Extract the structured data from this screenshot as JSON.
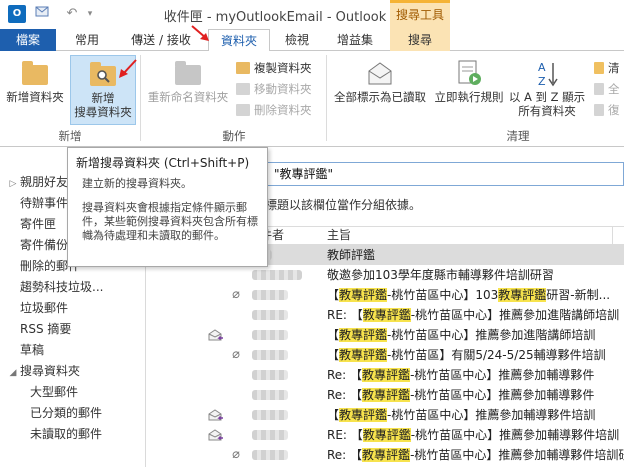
{
  "window": {
    "title": "收件匣 - myOutlookEmail - Outlook",
    "app_icon_label": "O"
  },
  "context_header": "搜尋工具",
  "tabs": [
    {
      "label": "檔案"
    },
    {
      "label": "常用"
    },
    {
      "label": "傳送 / 接收"
    },
    {
      "label": "資料夾"
    },
    {
      "label": "檢視"
    },
    {
      "label": "增益集"
    },
    {
      "label": "搜尋"
    }
  ],
  "ribbon": {
    "new_folder": "新增資料夾",
    "new_search_folder_line1": "新增",
    "new_search_folder_line2": "搜尋資料夾",
    "rename_folder": "重新命名資料夾",
    "copy_folder": "複製資料夾",
    "move_folder": "移動資料夾",
    "delete_folder": "刪除資料夾",
    "mark_all_read": "全部標示為已讀取",
    "run_rules_now": "立即執行規則",
    "sort_az_line1": "以 A 到 Z 顯示",
    "sort_az_line2": "所有資料夾",
    "cleanup_1": "清",
    "cleanup_2": "全",
    "cleanup_3": "復",
    "group_new": "新增",
    "group_actions": "動作",
    "group_cleanup": "清理"
  },
  "tooltip": {
    "title": "新增搜尋資料夾 (Ctrl+Shift+P)",
    "body1": "建立新的搜尋資料夾。",
    "body2": "搜尋資料夾會根據指定條件顯示郵件，某些範例搜尋資料夾包含所有標幟為待處理和未讀取的郵件。"
  },
  "folders": [
    {
      "label": "親朋好友",
      "indent": 0,
      "caret": "▷"
    },
    {
      "label": "待辦事件",
      "indent": 1,
      "caret": ""
    },
    {
      "label": "寄件匣",
      "indent": 1,
      "caret": ""
    },
    {
      "label": "寄件備份",
      "indent": 1,
      "caret": ""
    },
    {
      "label": "刪除的郵件",
      "indent": 1,
      "caret": ""
    },
    {
      "label": "趨勢科技垃圾...",
      "indent": 1,
      "caret": ""
    },
    {
      "label": "垃圾郵件",
      "indent": 1,
      "caret": ""
    },
    {
      "label": "RSS 摘要",
      "indent": 1,
      "caret": ""
    },
    {
      "label": "草稿",
      "indent": 1,
      "caret": ""
    },
    {
      "label": "搜尋資料夾",
      "indent": 0,
      "caret": "◢"
    },
    {
      "label": "大型郵件",
      "indent": 2,
      "caret": ""
    },
    {
      "label": "已分類的郵件",
      "indent": 2,
      "caret": ""
    },
    {
      "label": "未讀取的郵件",
      "indent": 2,
      "caret": ""
    }
  ],
  "search": {
    "query": "\"教專評鑑\""
  },
  "group_hint": "標題以該欄位當作分組依據。",
  "columns": {
    "sender": "件者",
    "subject": "主旨"
  },
  "messages": [
    {
      "parts": [
        "教師評鑑"
      ],
      "hl": [
        false
      ],
      "attach": false,
      "envelope": false,
      "sel": true,
      "blur": 20
    },
    {
      "parts": [
        "敬邀參加103學年度縣市輔導夥件培訓研習"
      ],
      "hl": [
        false
      ],
      "attach": false,
      "envelope": false,
      "sel": false,
      "blur": 50
    },
    {
      "parts": [
        "【",
        "教專評鑑",
        "-桃竹苗區中心】103",
        "教專評鑑",
        "研習-新制..."
      ],
      "hl": [
        false,
        true,
        false,
        true,
        false
      ],
      "attach": true,
      "envelope": false,
      "sel": false,
      "blur": 36
    },
    {
      "parts": [
        "RE: 【",
        "教專評鑑",
        "-桃竹苗區中心】推薦參加進階講師培訓"
      ],
      "hl": [
        false,
        true,
        false
      ],
      "attach": false,
      "envelope": false,
      "sel": false,
      "blur": 36
    },
    {
      "parts": [
        "【",
        "教專評鑑",
        "-桃竹苗區中心】推薦參加進階講師培訓"
      ],
      "hl": [
        false,
        true,
        false
      ],
      "attach": false,
      "envelope": true,
      "sel": false,
      "blur": 36
    },
    {
      "parts": [
        "【",
        "教專評鑑",
        "-桃竹苗區】有關5/24-5/25輔導夥件培訓"
      ],
      "hl": [
        false,
        true,
        false
      ],
      "attach": true,
      "envelope": false,
      "sel": false,
      "blur": 36
    },
    {
      "parts": [
        "Re: 【",
        "教專評鑑",
        "-桃竹苗區中心】推薦參加輔導夥件"
      ],
      "hl": [
        false,
        true,
        false
      ],
      "attach": false,
      "envelope": false,
      "sel": false,
      "blur": 36
    },
    {
      "parts": [
        "Re: 【",
        "教專評鑑",
        "-桃竹苗區中心】推薦參加輔導夥件"
      ],
      "hl": [
        false,
        true,
        false
      ],
      "attach": false,
      "envelope": false,
      "sel": false,
      "blur": 36
    },
    {
      "parts": [
        "【",
        "教專評鑑",
        "-桃竹苗區中心】推薦參加輔導夥件培訓"
      ],
      "hl": [
        false,
        true,
        false
      ],
      "attach": false,
      "envelope": true,
      "sel": false,
      "blur": 36
    },
    {
      "parts": [
        "RE: 【",
        "教專評鑑",
        "-桃竹苗區中心】推薦參加輔導夥件培訓"
      ],
      "hl": [
        false,
        true,
        false
      ],
      "attach": false,
      "envelope": true,
      "sel": false,
      "blur": 36
    },
    {
      "parts": [
        "Re: 【",
        "教專評鑑",
        "-桃竹苗區中心】推薦參加輔導夥件培訓研"
      ],
      "hl": [
        false,
        true,
        false
      ],
      "attach": true,
      "envelope": false,
      "sel": false,
      "blur": 36
    },
    {
      "parts": [
        "RE: 【",
        "教專評鑑",
        "-桃竹苗區中心】推薦參加初階講師"
      ],
      "hl": [
        false,
        true,
        false
      ],
      "attach": false,
      "envelope": false,
      "sel": false,
      "blur": 36
    }
  ],
  "colors": {
    "file_tab": "#1e5fae",
    "search_tools": "#fbe3b4",
    "highlight": "#f7e34d",
    "arrow": "#e02020"
  }
}
